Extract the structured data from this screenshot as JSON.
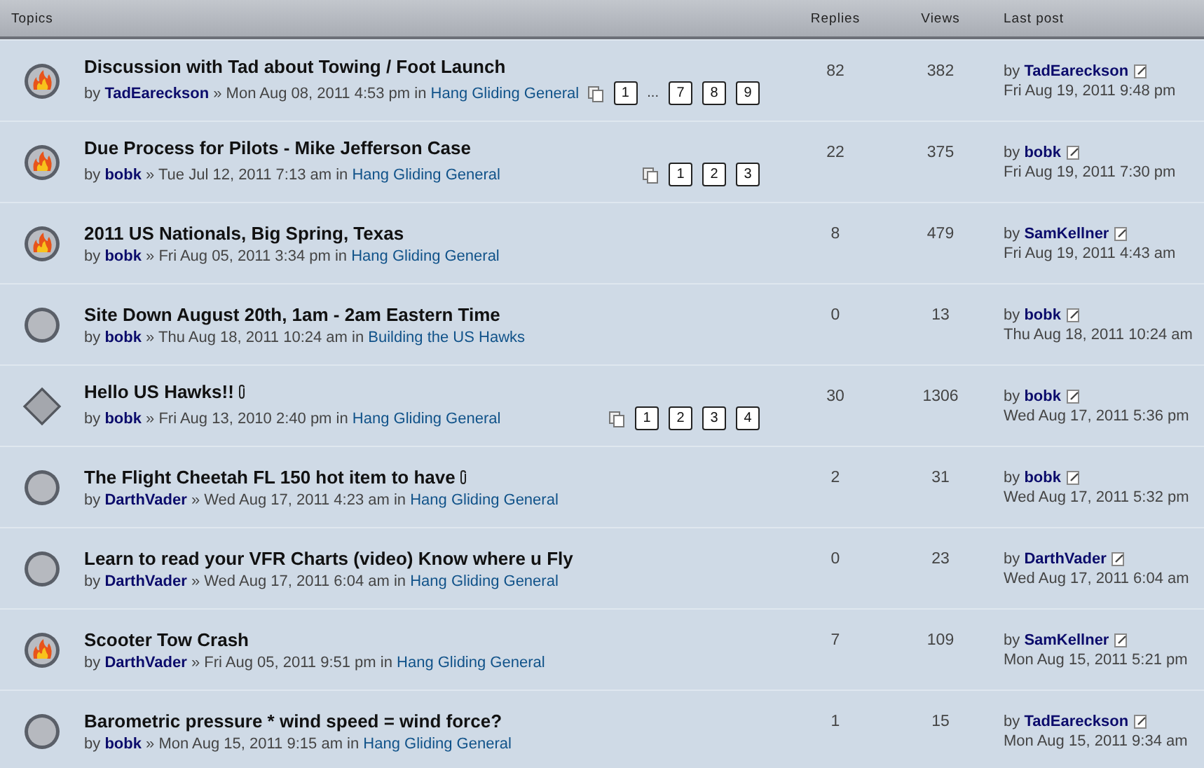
{
  "header": {
    "topics": "Topics",
    "replies": "Replies",
    "views": "Views",
    "last_post": "Last post"
  },
  "topics": [
    {
      "kind": "hot",
      "title": "Discussion with Tad about Towing / Foot Launch",
      "by": "by",
      "author": "TadEareckson",
      "sep": "»",
      "date": "Mon Aug 08, 2011 4:53 pm",
      "in": "in",
      "forum": "Hang Gliding General",
      "pages": [
        {
          "kind": "page",
          "label": "1"
        },
        {
          "kind": "gap",
          "label": "..."
        },
        {
          "kind": "page",
          "label": "7"
        },
        {
          "kind": "page",
          "label": "8"
        },
        {
          "kind": "page",
          "label": "9"
        }
      ],
      "replies": "82",
      "views": "382",
      "last_by": "by",
      "last_author": "TadEareckson",
      "last_date": "Fri Aug 19, 2011 9:48 pm"
    },
    {
      "kind": "hot",
      "title": "Due Process for Pilots - Mike Jefferson Case",
      "by": "by",
      "author": "bobk",
      "sep": "»",
      "date": "Tue Jul 12, 2011 7:13 am",
      "in": "in",
      "forum": "Hang Gliding General",
      "pages": [
        {
          "kind": "page",
          "label": "1"
        },
        {
          "kind": "page",
          "label": "2"
        },
        {
          "kind": "page",
          "label": "3"
        }
      ],
      "replies": "22",
      "views": "375",
      "last_by": "by",
      "last_author": "bobk",
      "last_date": "Fri Aug 19, 2011 7:30 pm"
    },
    {
      "kind": "hot",
      "title": "2011 US Nationals, Big Spring, Texas",
      "by": "by",
      "author": "bobk",
      "sep": "»",
      "date": "Fri Aug 05, 2011 3:34 pm",
      "in": "in",
      "forum": "Hang Gliding General",
      "replies": "8",
      "views": "479",
      "last_by": "by",
      "last_author": "SamKellner",
      "last_date": "Fri Aug 19, 2011 4:43 am"
    },
    {
      "kind": "normal",
      "title": "Site Down August 20th, 1am - 2am Eastern Time",
      "by": "by",
      "author": "bobk",
      "sep": "»",
      "date": "Thu Aug 18, 2011 10:24 am",
      "in": "in",
      "forum": "Building the US Hawks",
      "replies": "0",
      "views": "13",
      "last_by": "by",
      "last_author": "bobk",
      "last_date": "Thu Aug 18, 2011 10:24 am"
    },
    {
      "kind": "sticky",
      "title": "Hello US Hawks!!",
      "attachment": true,
      "by": "by",
      "author": "bobk",
      "sep": "»",
      "date": "Fri Aug 13, 2010 2:40 pm",
      "in": "in",
      "forum": "Hang Gliding General",
      "pages": [
        {
          "kind": "page",
          "label": "1"
        },
        {
          "kind": "page",
          "label": "2"
        },
        {
          "kind": "page",
          "label": "3"
        },
        {
          "kind": "page",
          "label": "4"
        }
      ],
      "replies": "30",
      "views": "1306",
      "last_by": "by",
      "last_author": "bobk",
      "last_date": "Wed Aug 17, 2011 5:36 pm"
    },
    {
      "kind": "normal",
      "title": "The Flight Cheetah FL 150 hot item to have",
      "attachment": true,
      "by": "by",
      "author": "DarthVader",
      "sep": "»",
      "date": "Wed Aug 17, 2011 4:23 am",
      "in": "in",
      "forum": "Hang Gliding General",
      "replies": "2",
      "views": "31",
      "last_by": "by",
      "last_author": "bobk",
      "last_date": "Wed Aug 17, 2011 5:32 pm"
    },
    {
      "kind": "normal",
      "title": "Learn to read your VFR Charts (video) Know where u Fly",
      "by": "by",
      "author": "DarthVader",
      "sep": "»",
      "date": "Wed Aug 17, 2011 6:04 am",
      "in": "in",
      "forum": "Hang Gliding General",
      "replies": "0",
      "views": "23",
      "last_by": "by",
      "last_author": "DarthVader",
      "last_date": "Wed Aug 17, 2011 6:04 am"
    },
    {
      "kind": "hot",
      "title": "Scooter Tow Crash",
      "by": "by",
      "author": "DarthVader",
      "sep": "»",
      "date": "Fri Aug 05, 2011 9:51 pm",
      "in": "in",
      "forum": "Hang Gliding General",
      "replies": "7",
      "views": "109",
      "last_by": "by",
      "last_author": "SamKellner",
      "last_date": "Mon Aug 15, 2011 5:21 pm"
    },
    {
      "kind": "normal",
      "title": "Barometric pressure * wind speed = wind force?",
      "by": "by",
      "author": "bobk",
      "sep": "»",
      "date": "Mon Aug 15, 2011 9:15 am",
      "in": "in",
      "forum": "Hang Gliding General",
      "replies": "1",
      "views": "15",
      "last_by": "by",
      "last_author": "TadEareckson",
      "last_date": "Mon Aug 15, 2011 9:34 am"
    }
  ]
}
